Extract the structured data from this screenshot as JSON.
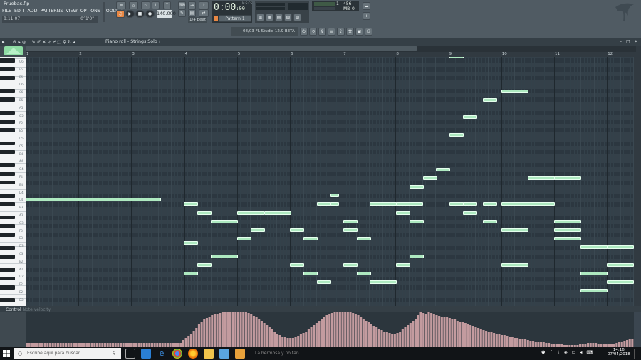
{
  "window": {
    "project_file": "Pruebas.flp"
  },
  "menu": [
    "FILE",
    "EDIT",
    "ADD",
    "PATTERNS",
    "VIEW",
    "OPTIONS",
    "TOOLS",
    "?"
  ],
  "hint": {
    "position": "8:11:07",
    "extra": "0°1'0\""
  },
  "transport": {
    "tempo": "140.000",
    "time": "0:00",
    "time_sub": ":00",
    "time_unit": "M:S:CS",
    "pattern": "Pattern 1",
    "snap": "1/4 beat"
  },
  "system": {
    "cpu": "1",
    "memory": "456 MB",
    "voices": "0"
  },
  "news": {
    "text": "08/03  FL Studio 12.9 BETA 4"
  },
  "piano_roll": {
    "title": "Piano roll - Strings Solo",
    "separator": "›",
    "bars": [
      "1",
      "2",
      "3",
      "4",
      "5",
      "6",
      "7",
      "8",
      "9",
      "10",
      "11",
      "12"
    ]
  },
  "keys": [
    "G6",
    "F6",
    "E6",
    "D6",
    "C6",
    "B5",
    "A5",
    "G5",
    "F5",
    "E5",
    "D5",
    "C5",
    "B4",
    "A4",
    "G4",
    "F4",
    "E4",
    "D4",
    "C4",
    "B3",
    "A3",
    "G3",
    "F3",
    "E3",
    "D3",
    "C3",
    "B2",
    "A2",
    "G2",
    "F2",
    "E2",
    "D2"
  ],
  "control": {
    "label": "Control",
    "target": "Note velocity"
  },
  "taskbar": {
    "search_placeholder": "Escribe aquí para buscar",
    "time": "14:16",
    "date": "07/04/2018",
    "notification": "La hermosa y no tan..."
  },
  "colors": {
    "note": "#aee9c0",
    "accent": "#e98844",
    "velocity": "#d4a6aa"
  },
  "velocity_data": [
    6,
    6,
    6,
    6,
    6,
    6,
    6,
    6,
    6,
    6,
    6,
    6,
    6,
    6,
    6,
    6,
    6,
    6,
    6,
    6,
    6,
    6,
    6,
    6,
    6,
    6,
    6,
    6,
    6,
    6,
    6,
    6,
    6,
    6,
    6,
    6,
    6,
    6,
    6,
    6,
    6,
    6,
    6,
    6,
    6,
    6,
    6,
    6,
    6,
    6,
    6,
    6,
    6,
    6,
    6,
    6,
    6,
    6,
    6,
    6,
    10,
    13,
    16,
    19,
    23,
    27,
    32,
    35,
    39,
    41,
    43,
    45,
    46,
    47,
    48,
    49,
    50,
    50,
    50,
    50,
    50,
    50,
    50,
    50,
    49,
    48,
    46,
    44,
    42,
    40,
    37,
    34,
    31,
    28,
    25,
    22,
    19,
    17,
    15,
    14,
    13,
    13,
    13,
    14,
    16,
    18,
    20,
    22,
    25,
    28,
    31,
    34,
    37,
    40,
    43,
    45,
    47,
    48,
    50,
    50,
    51,
    51,
    51,
    50,
    49,
    48,
    47,
    45,
    43,
    40,
    37,
    35,
    32,
    30,
    28,
    26,
    24,
    22,
    21,
    20,
    19,
    19,
    20,
    22,
    25,
    28,
    31,
    34,
    37,
    40,
    45,
    50,
    48,
    46,
    49,
    48,
    47,
    45,
    44,
    43,
    43,
    42,
    41,
    40,
    39,
    37,
    36,
    35,
    34,
    33,
    31,
    30,
    28,
    27,
    25,
    24,
    23,
    22,
    21,
    20,
    19,
    18,
    17,
    17,
    16,
    15,
    14,
    13,
    13,
    12,
    11,
    11,
    10,
    9,
    9,
    8,
    8,
    7,
    7,
    6,
    6,
    5,
    5,
    4,
    4,
    4,
    3,
    3,
    3,
    3,
    3,
    3,
    4,
    5,
    5,
    6,
    6,
    6,
    6,
    5,
    5,
    4,
    4,
    4,
    4,
    5,
    6,
    7,
    8,
    9,
    10,
    11,
    12
  ]
}
